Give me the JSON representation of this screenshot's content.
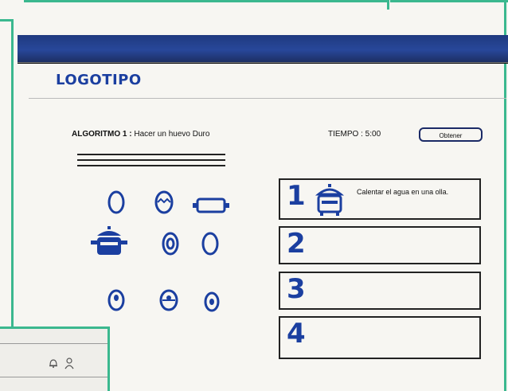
{
  "header": {
    "logo_text": "LOGOTIPO"
  },
  "algorithm": {
    "label": "ALGORITMO 1 :",
    "title": "Hacer un huevo Duro",
    "time_label": "TIEMPO : 5:00",
    "button_label": "Obtener"
  },
  "steps": [
    {
      "number": "1",
      "text": "Calentar el agua en una olla."
    },
    {
      "number": "2",
      "text": ""
    },
    {
      "number": "3",
      "text": ""
    },
    {
      "number": "4",
      "text": ""
    }
  ],
  "palette": [
    "egg-icon",
    "egg-icon",
    "sausage-icon",
    "pot-icon",
    "egg-icon",
    "egg-icon",
    "egg-icon",
    "egg-icon",
    "egg-icon"
  ],
  "colors": {
    "accent": "#3bb88f",
    "ink": "#1b3fa0",
    "header_bar": "#28479a"
  }
}
